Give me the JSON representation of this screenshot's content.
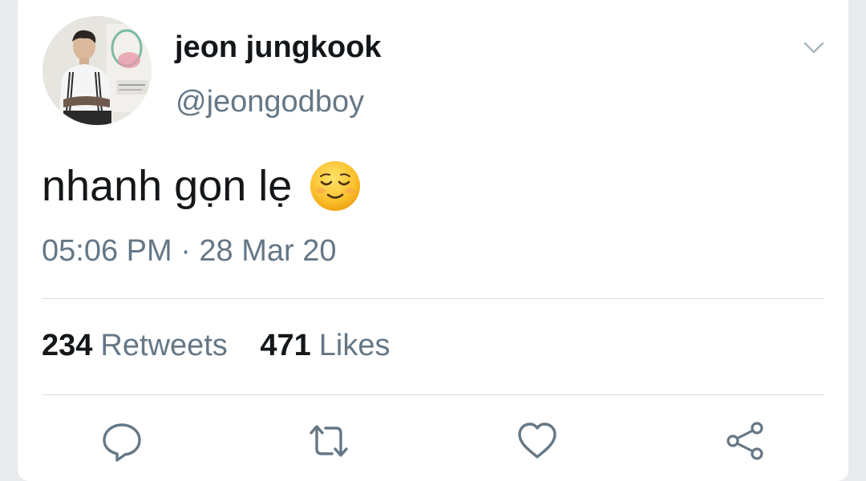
{
  "tweet": {
    "author": {
      "display_name": "jeon jungkook",
      "handle": "@jeongodboy"
    },
    "text": "nhanh gọn lẹ",
    "emoji": "relieved-face",
    "timestamp": "05:06 PM · 28 Mar 20",
    "stats": {
      "retweets_count": "234",
      "retweets_label": "Retweets",
      "likes_count": "471",
      "likes_label": "Likes"
    }
  },
  "icons": {
    "menu": "chevron-down-icon",
    "reply": "reply-icon",
    "retweet": "retweet-icon",
    "like": "heart-icon",
    "share": "share-icon"
  },
  "colors": {
    "primary_text": "#14171a",
    "secondary_text": "#657786",
    "divider": "#d8dee3",
    "background": "#e9ebed"
  }
}
